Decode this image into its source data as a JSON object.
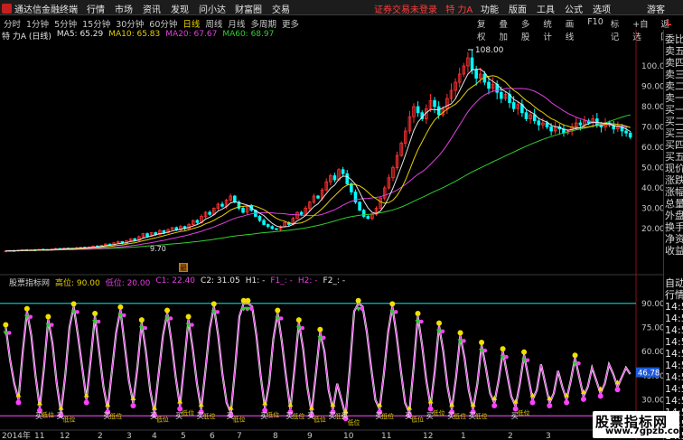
{
  "window": {
    "app_name": "通达信金融终端",
    "menu": [
      "行情",
      "市场",
      "资讯",
      "发现",
      "问小达",
      "财富圈",
      "交易"
    ],
    "login_status": "证券交易未登录",
    "stock_title": "特 力A",
    "right_menu": [
      "功能",
      "版面",
      "工具",
      "公式",
      "选项"
    ],
    "guest_label": "游客",
    "l_tag": "L"
  },
  "period_tabs": [
    "分时",
    "1分钟",
    "5分钟",
    "15分钟",
    "30分钟",
    "60分钟",
    "日线",
    "周线",
    "月线",
    "多周期",
    "更多"
  ],
  "active_period": "日线",
  "toolbar": [
    "复权",
    "叠加",
    "多股",
    "统计",
    "画线",
    "F10",
    "标记",
    "+自选",
    "返回"
  ],
  "main_header": {
    "name": "特 力A (日线)",
    "ma": [
      {
        "label": "MA5: 65.29",
        "color": "#e6e6e6"
      },
      {
        "label": "MA10: 65.83",
        "color": "#e8d000"
      },
      {
        "label": "MA20: 67.67",
        "color": "#e040e0"
      },
      {
        "label": "MA60: 68.97",
        "color": "#30d030"
      }
    ]
  },
  "indicator_header": [
    {
      "label": "股票指标网",
      "color": "#d0d0d0"
    },
    {
      "label": "高位: 90.00",
      "color": "#e8d000"
    },
    {
      "label": "低位: 20.00",
      "color": "#e040e0"
    },
    {
      "label": "C1: 22.40",
      "color": "#e040e0"
    },
    {
      "label": "C2: 31.05",
      "color": "#e6e6e6"
    },
    {
      "label": "H1: -",
      "color": "#e6e6e6"
    },
    {
      "label": "F1_: -",
      "color": "#e040e0"
    },
    {
      "label": "H2: -",
      "color": "#e040e0"
    },
    {
      "label": "F2_: -",
      "color": "#e6e6e6"
    }
  ],
  "price_axis": [
    "100.0",
    "90.00",
    "80.00",
    "70.00",
    "60.00",
    "50.00",
    "40.00",
    "30.00",
    "20.00"
  ],
  "max_label": "108.00",
  "min_label": "9.70",
  "indicator_axis": [
    "90.00",
    "75.00",
    "60.00",
    "45.00",
    "30.00"
  ],
  "indicator_current": "46.78",
  "date_axis": [
    "2014年",
    "11",
    "12",
    "2",
    "3",
    "4",
    "5",
    "6",
    "7",
    "8",
    "9",
    "10",
    "11",
    "12",
    "1",
    "2",
    "3"
  ],
  "sell_label": "卖",
  "buy_label": "买",
  "low_label": "低位",
  "sidebar_items": [
    "委比",
    "卖五",
    "卖四",
    "卖三",
    "卖二",
    "卖一",
    "买一",
    "买二",
    "买三",
    "买四",
    "买五",
    "现价",
    "涨跌",
    "涨幅",
    "总量",
    "外盘",
    "换手",
    "净资",
    "收益"
  ],
  "minute_items": [
    "自动",
    "行情",
    "14:5",
    "14:5",
    "14:5",
    "14:5",
    "14:5",
    "14:5",
    "14:5",
    "14:5",
    "14:5",
    "14:5",
    "14:5",
    "14:5"
  ],
  "marker_text": "最",
  "watermark": {
    "title": "股票指标网",
    "url": "www.7gpzb.com"
  },
  "colors": {
    "up_candle": "#ff3232",
    "down_candle": "#00ffff",
    "ma5": "#e6e6e6",
    "ma10": "#e8d000",
    "ma20": "#e040e0",
    "ma60": "#30d030",
    "high_line": "#00c0c0",
    "low_line": "#d040d0"
  },
  "chart_data": {
    "type": "candlestick",
    "ylim": [
      0,
      112
    ],
    "close": [
      9.0,
      9.2,
      9.0,
      9.4,
      9.6,
      9.3,
      9.5,
      9.4,
      9.8,
      9.7,
      9.5,
      9.9,
      10.2,
      10.0,
      10.4,
      10.3,
      10.1,
      10.6,
      10.8,
      10.5,
      11.0,
      11.4,
      11.2,
      11.8,
      12.4,
      12.0,
      13.0,
      13.6,
      12.8,
      14.0,
      15.0,
      14.2,
      16.0,
      17.5,
      16.2,
      18.0,
      17.0,
      19.0,
      18.0,
      19.5,
      20.5,
      19.4,
      21.0,
      20.0,
      22.0,
      24.0,
      23.0,
      26.0,
      28.0,
      27.0,
      30.0,
      32.0,
      31.0,
      34.0,
      36.0,
      33.0,
      30.0,
      28.0,
      31.0,
      29.0,
      26.0,
      24.0,
      22.0,
      21.0,
      20.0,
      19.5,
      21.0,
      23.0,
      22.0,
      25.0,
      28.0,
      27.0,
      30.0,
      33.0,
      36.0,
      35.0,
      39.0,
      43.0,
      46.0,
      44.0,
      49.0,
      47.0,
      42.0,
      38.0,
      33.0,
      29.0,
      26.0,
      25.0,
      27.0,
      30.0,
      35.0,
      40.0,
      45.0,
      50.0,
      56.0,
      62.0,
      68.0,
      75.0,
      80.0,
      77.0,
      74.0,
      79.0,
      83.0,
      80.0,
      76.0,
      79.0,
      84.0,
      88.0,
      92.0,
      96.0,
      100.0,
      104.0,
      98.0,
      94.0,
      96.0,
      92.0,
      89.0,
      91.0,
      87.0,
      84.0,
      86.0,
      82.0,
      79.0,
      81.0,
      77.0,
      74.0,
      76.0,
      73.0,
      71.0,
      72.0,
      70.0,
      68.0,
      70.0,
      69.0,
      67.0,
      68.0,
      70.0,
      72.0,
      71.0,
      73.0,
      72.0,
      74.0,
      71.0,
      70.0,
      72.0,
      71.0,
      69.0,
      70.0,
      68.0,
      67.0,
      65.0
    ],
    "indicator_values": [
      75,
      55,
      40,
      30,
      60,
      85,
      70,
      45,
      25,
      50,
      80,
      65,
      40,
      22,
      45,
      75,
      88,
      70,
      50,
      30,
      55,
      82,
      60,
      38,
      24,
      48,
      72,
      86,
      64,
      42,
      28,
      50,
      78,
      60,
      36,
      22,
      46,
      70,
      84,
      66,
      44,
      26,
      52,
      80,
      62,
      40,
      24,
      48,
      74,
      88,
      70,
      46,
      28,
      22,
      50,
      82,
      90,
      90,
      88,
      70,
      45,
      25,
      40,
      68,
      84,
      66,
      44,
      24,
      50,
      78,
      62,
      38,
      22,
      46,
      72,
      60,
      36,
      24,
      40,
      30,
      20,
      50,
      85,
      90,
      88,
      72,
      50,
      30,
      24,
      46,
      72,
      88,
      70,
      48,
      28,
      22,
      50,
      82,
      64,
      42,
      26,
      48,
      76,
      60,
      38,
      24,
      44,
      70,
      56,
      36,
      24,
      40,
      64,
      50,
      34,
      28,
      42,
      60,
      46,
      32,
      26,
      40,
      58,
      44,
      30,
      36,
      52,
      40,
      28,
      34,
      48,
      38,
      30,
      42,
      56,
      44,
      32,
      38,
      50,
      42,
      34,
      40,
      52,
      46,
      38,
      44,
      50,
      46
    ],
    "indicator_ylim": [
      10,
      100
    ],
    "high_level": 90,
    "low_level": 20
  }
}
